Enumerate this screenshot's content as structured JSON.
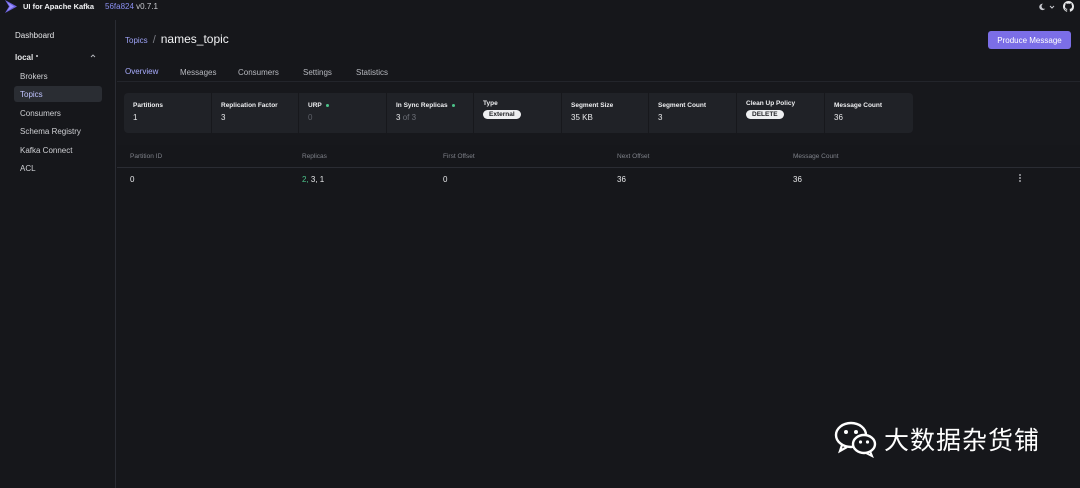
{
  "app": {
    "title": "UI for Apache Kafka",
    "commit": "56fa824",
    "version": "v0.7.1"
  },
  "sidebar": {
    "dashboard_label": "Dashboard",
    "cluster_name": "local",
    "items": [
      {
        "label": "Brokers"
      },
      {
        "label": "Topics"
      },
      {
        "label": "Consumers"
      },
      {
        "label": "Schema Registry"
      },
      {
        "label": "Kafka Connect"
      },
      {
        "label": "ACL"
      }
    ],
    "active_item": "Topics"
  },
  "breadcrumb": {
    "parent": "Topics",
    "separator": "/",
    "current": "names_topic"
  },
  "produce_button": "Produce Message",
  "tabs": [
    {
      "label": "Overview"
    },
    {
      "label": "Messages"
    },
    {
      "label": "Consumers"
    },
    {
      "label": "Settings"
    },
    {
      "label": "Statistics"
    }
  ],
  "active_tab": "Overview",
  "metrics": {
    "partitions": {
      "label": "Partitions",
      "value": "1"
    },
    "replication_factor": {
      "label": "Replication Factor",
      "value": "3"
    },
    "urp": {
      "label": "URP",
      "value": "0"
    },
    "in_sync_replicas": {
      "label": "In Sync Replicas",
      "value": "3",
      "of": "of 3"
    },
    "type": {
      "label": "Type",
      "value": "External"
    },
    "segment_size": {
      "label": "Segment Size",
      "value": "35 KB"
    },
    "segment_count": {
      "label": "Segment Count",
      "value": "3"
    },
    "cleanup_policy": {
      "label": "Clean Up Policy",
      "value": "DELETE"
    },
    "message_count": {
      "label": "Message Count",
      "value": "36"
    }
  },
  "table": {
    "columns": [
      "Partition ID",
      "Replicas",
      "First Offset",
      "Next Offset",
      "Message Count"
    ],
    "rows": [
      {
        "partition_id": "0",
        "replica_leader": "2,",
        "replicas_rest": " 3, 1",
        "first_offset": "0",
        "next_offset": "36",
        "message_count": "36"
      }
    ]
  },
  "watermark": {
    "text": "大数据杂货铺",
    "icon": "wechat-icon"
  },
  "colors": {
    "background": "#16171b",
    "accent": "#7b6ee7",
    "link": "#9da2f6",
    "success": "#4cc38a"
  }
}
